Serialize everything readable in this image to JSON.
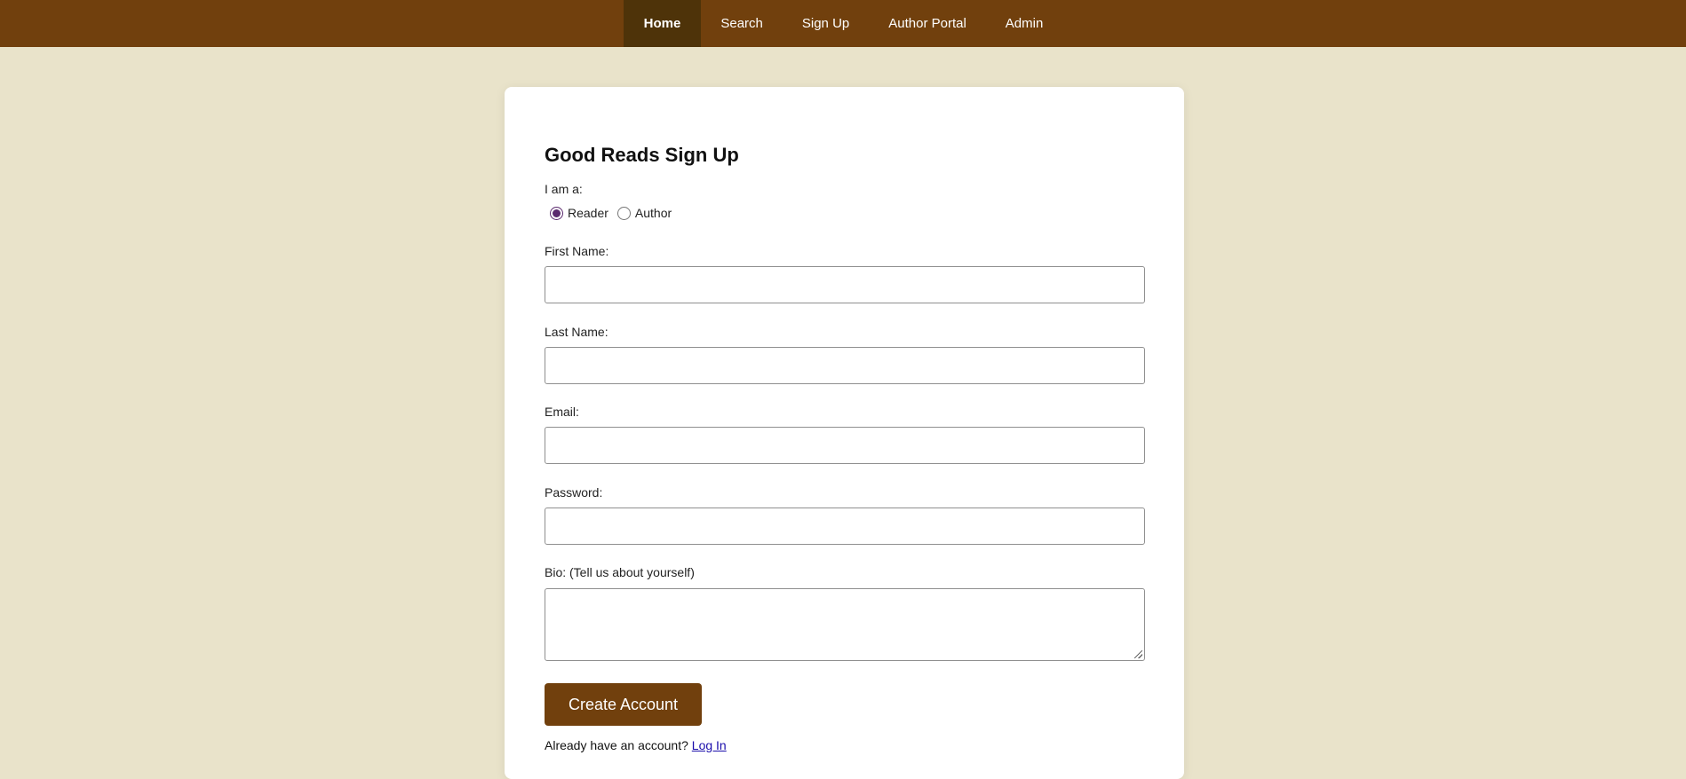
{
  "nav": {
    "items": [
      {
        "label": "Home",
        "active": true
      },
      {
        "label": "Search",
        "active": false
      },
      {
        "label": "Sign Up",
        "active": false
      },
      {
        "label": "Author Portal",
        "active": false
      },
      {
        "label": "Admin",
        "active": false
      }
    ]
  },
  "form": {
    "title": "Good Reads Sign Up",
    "role_label": "I am a:",
    "roles": [
      {
        "label": "Reader",
        "checked": true
      },
      {
        "label": "Author",
        "checked": false
      }
    ],
    "first_name_label": "First Name:",
    "first_name_value": "",
    "last_name_label": "Last Name:",
    "last_name_value": "",
    "email_label": "Email:",
    "email_value": "",
    "password_label": "Password:",
    "password_value": "",
    "bio_label": "Bio: (Tell us about yourself)",
    "bio_value": "",
    "submit_label": "Create Account",
    "login_prompt": "Already have an account?",
    "login_link": "Log In"
  },
  "colors": {
    "nav_bg": "#71400d",
    "nav_active_bg": "#4e3309",
    "page_bg": "#e9e3ca",
    "button_bg": "#71400d",
    "radio_accent": "#5b2a6e",
    "link": "#1a0dab"
  }
}
